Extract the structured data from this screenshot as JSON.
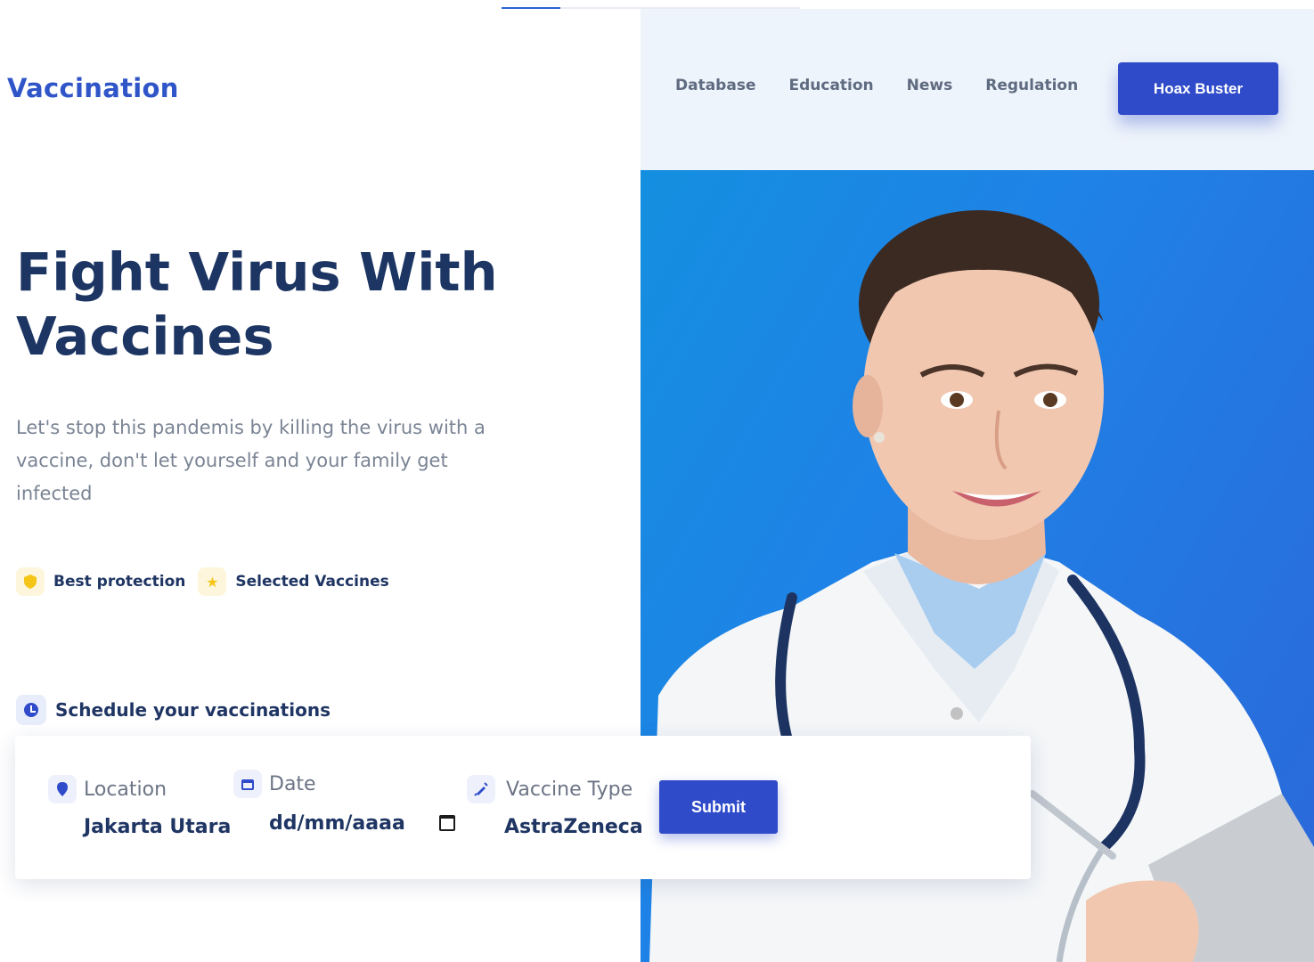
{
  "brand": "Vaccination",
  "nav": {
    "links": [
      "Database",
      "Education",
      "News",
      "Regulation"
    ],
    "cta": "Hoax Buster"
  },
  "hero": {
    "headline_line1": "Fight Virus With",
    "headline_line2": "Vaccines",
    "subtext": "Let's stop this pandemis by killing the virus with a vaccine, don't let yourself and your family get infected"
  },
  "features": [
    {
      "label": "Best protection",
      "icon": "shield-icon"
    },
    {
      "label": "Selected Vaccines",
      "icon": "star-icon"
    }
  ],
  "schedule": {
    "heading": "Schedule your vaccinations",
    "location_label": "Location",
    "location_value": "Jakarta Utara",
    "date_label": "Date",
    "date_placeholder": "dd/mm/aaaa",
    "vaccine_label": "Vaccine Type",
    "vaccine_value": "AstraZeneca",
    "submit": "Submit"
  },
  "colors": {
    "brand": "#2f55c8",
    "primary_button": "#2f4bc9",
    "headline": "#1c3563",
    "hero_blue": "#1f82e6",
    "feature_icon": "#f5c518"
  }
}
